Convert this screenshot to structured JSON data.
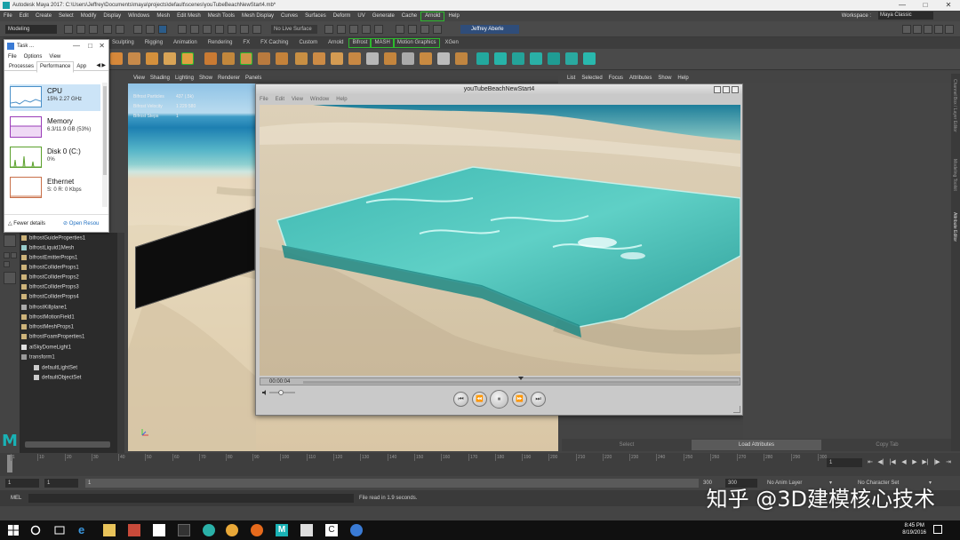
{
  "window": {
    "title": "Autodesk Maya 2017: C:\\Users\\Jeffrey\\Documents\\maya\\projects\\default\\scenes\\youTubeBeachNewStart4.mb*",
    "min_glyph": "—",
    "max_glyph": "□",
    "close_glyph": "✕"
  },
  "menubar": {
    "items": [
      "File",
      "Edit",
      "Create",
      "Select",
      "Modify",
      "Display",
      "Windows",
      "Mesh",
      "Edit Mesh",
      "Mesh Tools",
      "Mesh Display",
      "Curves",
      "Surfaces",
      "Deform",
      "UV",
      "Generate",
      "Cache",
      "Arnold",
      "Help"
    ],
    "workspace_label": "Workspace :",
    "workspace_value": "Maya Classic"
  },
  "statusline": {
    "mode": "Modeling",
    "live_surface": "No Live Surface",
    "user": "Jeffrey Aberle"
  },
  "shelf_tabs": [
    "Sculpting",
    "Rigging",
    "Animation",
    "Rendering",
    "FX",
    "FX Caching",
    "Custom",
    "Arnold",
    "Bifrost",
    "MASH",
    "Motion Graphics",
    "XGen"
  ],
  "task_manager": {
    "title": "Task ...",
    "min_glyph": "—",
    "max_glyph": "□",
    "close_glyph": "✕",
    "menu": [
      "File",
      "Options",
      "View"
    ],
    "tabs": [
      "Processes",
      "Performance",
      "App"
    ],
    "items": [
      {
        "name": "CPU",
        "value": "15%  2.27 GHz"
      },
      {
        "name": "Memory",
        "value": "6.3/11.9 GB (53%)"
      },
      {
        "name": "Disk 0 (C:)",
        "value": "0%"
      },
      {
        "name": "Ethernet",
        "value": "S: 0 R: 0 Kbps"
      }
    ],
    "fewer_details": "Fewer details",
    "open_resource": "Open Resou"
  },
  "outliner": {
    "items": [
      "bifrostGuideProperties1",
      "bifrostLiquid1Mesh",
      "bifrostEmitterProps1",
      "bifrostColliderProps1",
      "bifrostColliderProps2",
      "bifrostColliderProps3",
      "bifrostColliderProps4",
      "bifrostKillplane1",
      "bifrostMotionField1",
      "bifrostMeshProps1",
      "bifrostFoamProperties1",
      "aiSkyDomeLight1",
      "transform1",
      "defaultLightSet",
      "defaultObjectSet"
    ]
  },
  "viewport": {
    "menu": [
      "View",
      "Shading",
      "Lighting",
      "Show",
      "Renderer",
      "Panels"
    ],
    "hud": [
      {
        "label": "Bifrost Particles",
        "value": "437 (.5k)"
      },
      {
        "label": "Bifrost Velocity",
        "value": "1 229 580"
      },
      {
        "label": "Bifrost Steps",
        "value": "1"
      }
    ]
  },
  "video_player": {
    "title": "youTubeBeachNewStart4",
    "menu": [
      "File",
      "Edit",
      "View",
      "Window",
      "Help"
    ],
    "time": "00:00:04",
    "progress": 0.5,
    "volume": 0.45,
    "controls": {
      "start": "⏮",
      "rewind": "⏪",
      "pause": "⏸",
      "forward": "⏩",
      "end": "⏭"
    }
  },
  "right_panel": {
    "menu": [
      "List",
      "Selected",
      "Focus",
      "Attributes",
      "Show",
      "Help"
    ],
    "buttons": [
      "Select",
      "Load Attributes",
      "Copy Tab"
    ],
    "side_tabs": [
      "Channel Box / Layer Editor",
      "Modeling Toolkit",
      "Attribute Editor"
    ]
  },
  "timeline": {
    "ticks": [
      "1",
      "10",
      "20",
      "30",
      "40",
      "50",
      "60",
      "70",
      "80",
      "90",
      "100",
      "110",
      "120",
      "130",
      "140",
      "150",
      "160",
      "170",
      "180",
      "190",
      "200",
      "210",
      "220",
      "230",
      "240",
      "250",
      "260",
      "270",
      "280",
      "290",
      "300"
    ],
    "current_frame": "1"
  },
  "range": {
    "start": "1",
    "start2": "1",
    "slider_start": "1",
    "end": "300",
    "end2": "300",
    "anim_layer": "No Anim Layer",
    "char_set": "No Character Set"
  },
  "cmdline": {
    "mode": "MEL",
    "message": "File read in  1.9 seconds."
  },
  "watermark": "知乎 @3D建模核心技术",
  "taskbar": {
    "time": "8:45 PM",
    "date": "8/19/2016"
  },
  "colors": {
    "maya_teal": "#19b2b5",
    "highlight_green": "#2dbb2d",
    "water": "#4fc7c4"
  }
}
